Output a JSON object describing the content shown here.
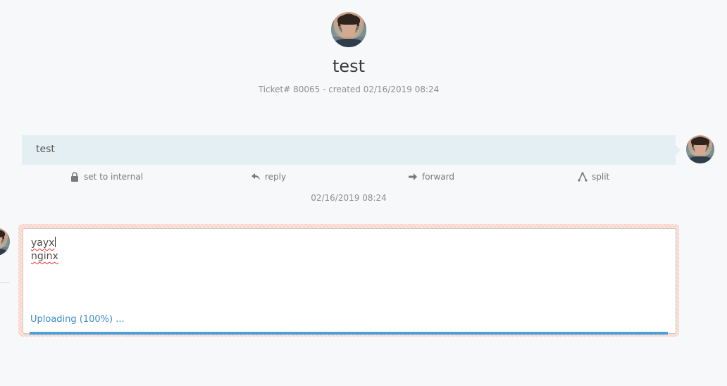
{
  "ticket": {
    "title": "test",
    "meta": "Ticket# 80065 - created 02/16/2019 08:24"
  },
  "article": {
    "body": "test",
    "timestamp": "02/16/2019 08:24"
  },
  "actions": {
    "internal": "set to internal",
    "reply": "reply",
    "forward": "forward",
    "split": "split"
  },
  "compose": {
    "line1": "yayx",
    "line2": "nginx",
    "upload_status": "Uploading (100%) ...",
    "progress": 1.0
  },
  "colors": {
    "accent": "#4a9fdb",
    "article_bg": "#e4eff4"
  }
}
